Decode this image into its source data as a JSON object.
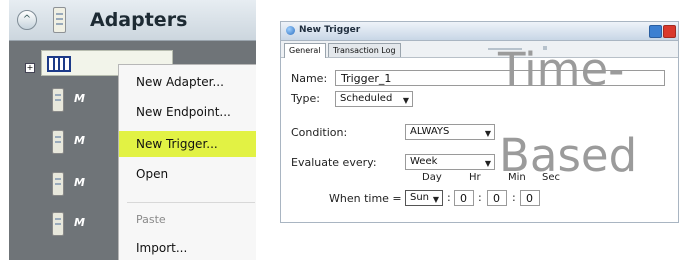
{
  "left_panel": {
    "title": "Adapters",
    "collapse_glyph": "^",
    "expand_glyph": "+",
    "row_labels": [
      "M",
      "M",
      "M",
      "M"
    ],
    "context_menu": {
      "items": [
        "New Adapter...",
        "New Endpoint...",
        "New Trigger...",
        "Open",
        "Paste",
        "Import..."
      ],
      "highlighted": "New Trigger..."
    }
  },
  "dialog": {
    "title": "New Trigger",
    "tabs": [
      "General",
      "Transaction Log"
    ],
    "active_tab": "General",
    "name_label": "Name:",
    "name_value": "Trigger_1",
    "type_label": "Type:",
    "type_value": "Scheduled",
    "condition_label": "Condition:",
    "condition_value": "ALWAYS",
    "evaluate_label": "Evaluate every:",
    "evaluate_value": "Week",
    "when_label": "When time =",
    "col_day": "Day",
    "col_hr": "Hr",
    "col_min": "Min",
    "col_sec": "Sec",
    "day_value": "Sun",
    "hr_value": "0",
    "min_value": "0",
    "sec_value": "0"
  },
  "overlay": {
    "line1": "Time-",
    "line2": "Based"
  },
  "colors": {
    "panel_bg": "#6f7478",
    "menu_highlight": "#e2f244",
    "overlay_text": "#9b9b9b",
    "dialog_border": "#a9b5c2"
  }
}
